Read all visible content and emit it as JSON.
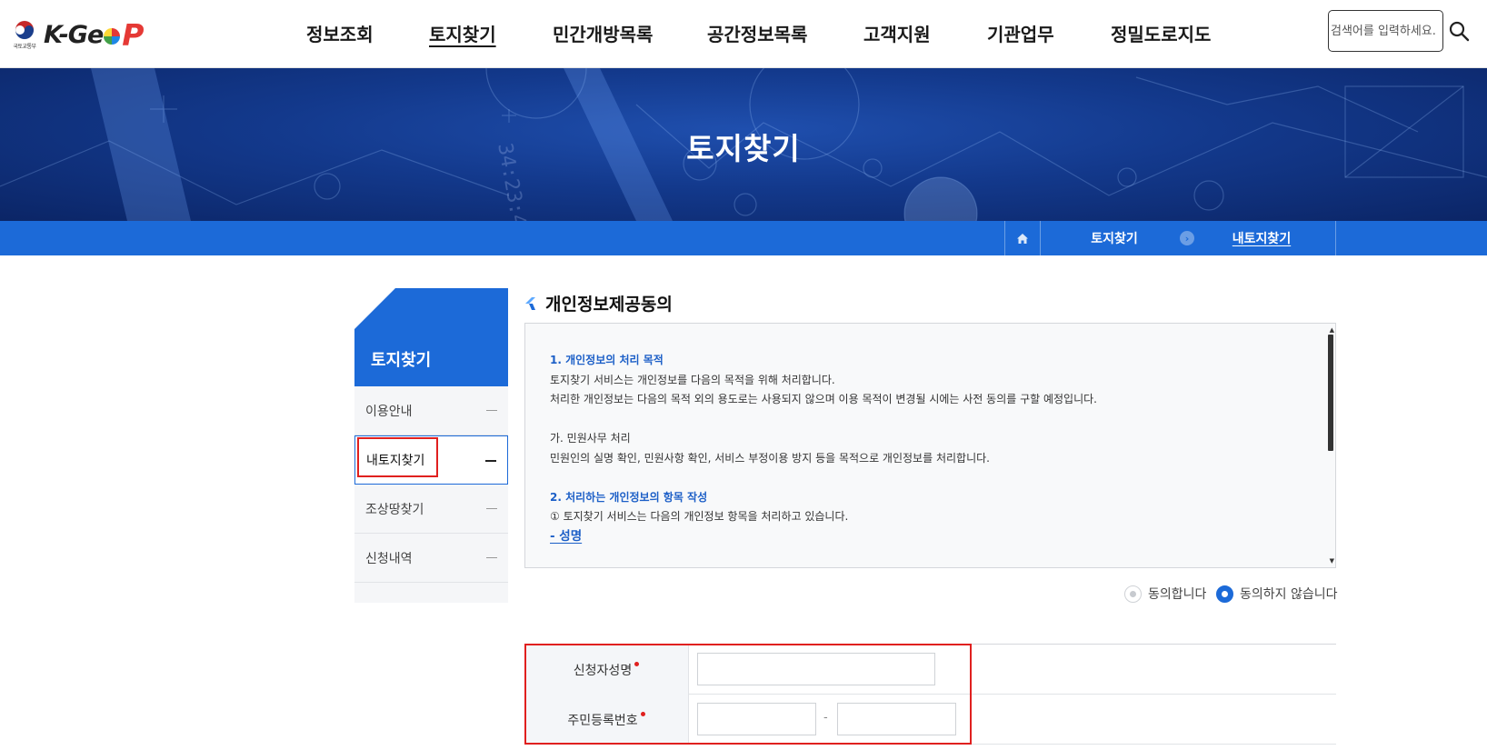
{
  "header": {
    "emblem_text": "국토교통부",
    "brand_prefix": "K-Ge",
    "brand_suffix": "P",
    "nav": [
      "정보조회",
      "토지찾기",
      "민간개방목록",
      "공간정보목록",
      "고객지원",
      "기관업무",
      "정밀도로지도"
    ],
    "search_placeholder": "검색어를 입력하세요."
  },
  "banner": {
    "title": "토지찾기"
  },
  "breadcrumb": {
    "level1": "토지찾기",
    "level2": "내토지찾기"
  },
  "sidebar": {
    "title": "토지찾기",
    "items": [
      "이용안내",
      "내토지찾기",
      "조상땅찾기",
      "신청내역"
    ],
    "active_index": 1
  },
  "section": {
    "title": "개인정보제공동의"
  },
  "terms": {
    "h1": "1. 개인정보의 처리 목적",
    "p1": "토지찾기 서비스는 개인정보를 다음의 목적을 위해 처리합니다.",
    "p2": "처리한 개인정보는 다음의 목적 외의 용도로는 사용되지 않으며 이용 목적이 변경될 시에는 사전 동의를 구할 예정입니다.",
    "h2": "가. 민원사무 처리",
    "p3": "민원인의 실명 확인, 민원사항 확인, 서비스 부정이용 방지 등을 목적으로 개인정보를 처리합니다.",
    "h3": "2. 처리하는 개인정보의 항목 작성",
    "p4": "① 토지찾기 서비스는 다음의 개인정보 항목을 처리하고 있습니다.",
    "link": "- 성명"
  },
  "consent": {
    "agree": "동의합니다",
    "disagree": "동의하지 않습니다",
    "selected": "disagree"
  },
  "form": {
    "name_label": "신청자성명",
    "rrn_label": "주민등록번호",
    "rrn_separator": "-"
  },
  "colors": {
    "accent": "#1c6ad8",
    "highlight": "#e0201f"
  }
}
